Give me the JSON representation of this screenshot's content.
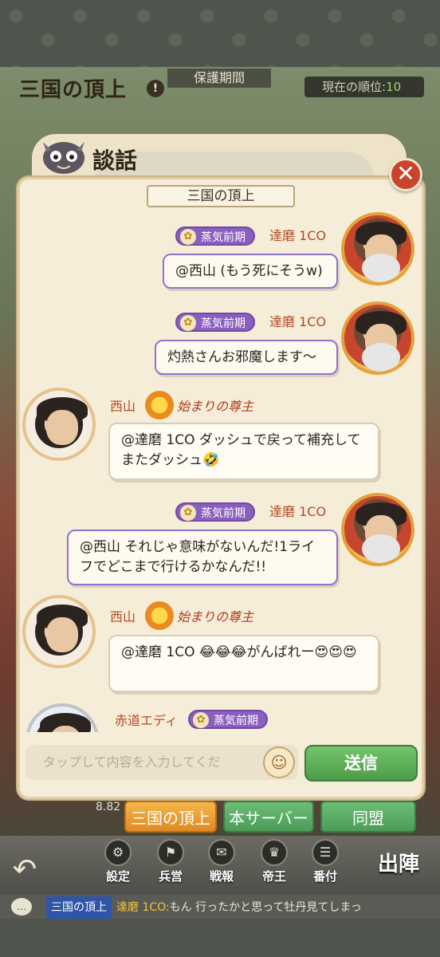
{
  "game": {
    "title": "三国の頂上",
    "protect": "保護期間",
    "rank_label": "現在の順位:",
    "rank_value": "10",
    "level": "8.82"
  },
  "panel": {
    "title": "談話",
    "channel": "三国の頂上",
    "close": "✕"
  },
  "messages": [
    {
      "id": 1,
      "name": "達磨 1CO",
      "badge": "蒸気前期",
      "text": "@西山 (もう死にそうw)"
    },
    {
      "id": 2,
      "name": "達磨 1CO",
      "badge": "蒸気前期",
      "text": "灼熱さんお邪魔します～"
    },
    {
      "id": 3,
      "name": "西山",
      "badge": "始まりの尊主",
      "text": "@達磨 1CO ダッシュで戻って補充してまたダッシュ🤣"
    },
    {
      "id": 4,
      "name": "達磨 1CO",
      "badge": "蒸気前期",
      "text": "@西山 それじゃ意味がないんだ!1ライフでどこまで行けるかなんだ!!"
    },
    {
      "id": 5,
      "name": "西山",
      "badge": "始まりの尊主",
      "text": "@達磨 1CO 😂😂😂がんばれー😍😍😍"
    },
    {
      "id": 6,
      "name": "赤道エディ",
      "badge": "蒸気前期",
      "text": ""
    }
  ],
  "input": {
    "placeholder": "タップして内容を入力してくだ",
    "emoji_icon": "smiley-icon",
    "send": "送信"
  },
  "tabs": [
    "三国の頂上",
    "本サーバー",
    "同盟"
  ],
  "nav": [
    {
      "label": "設定",
      "icon": "gear-icon",
      "glyph": "⚙"
    },
    {
      "label": "兵営",
      "icon": "barracks-icon",
      "glyph": "⚑"
    },
    {
      "label": "戦報",
      "icon": "report-icon",
      "glyph": "✉"
    },
    {
      "label": "帝王",
      "icon": "emperor-icon",
      "glyph": "♛"
    },
    {
      "label": "番付",
      "icon": "ranking-icon",
      "glyph": "☰"
    }
  ],
  "sortie": "出陣",
  "ticker": {
    "channel": "三国の頂上",
    "name": "達磨 1CO:",
    "text": "もん 行ったかと思って牡丹見てしまっ"
  }
}
